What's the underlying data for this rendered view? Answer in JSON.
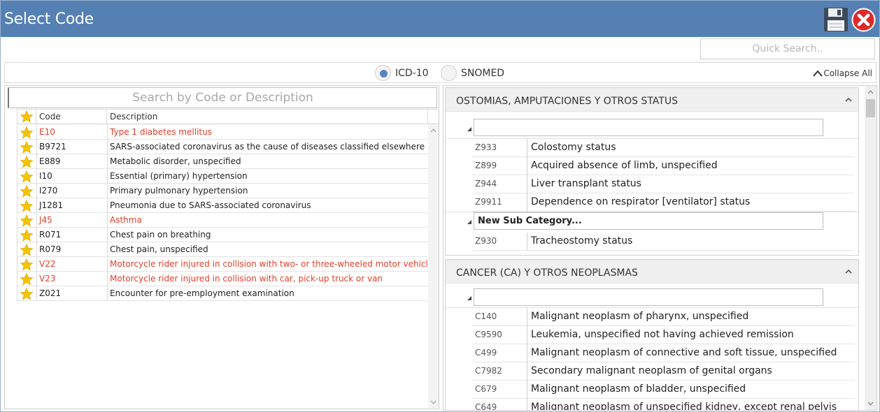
{
  "window": {
    "title": "Select Code",
    "save_icon": "floppy-disk-icon",
    "close_icon": "close-x-icon"
  },
  "quick_search": {
    "placeholder": "Quick Search.."
  },
  "code_system": {
    "options": [
      {
        "label": "ICD-10",
        "selected": true
      },
      {
        "label": "SNOMED",
        "selected": false
      }
    ],
    "collapse_all_label": "Collapse All"
  },
  "favorites": {
    "search_placeholder": "Search by Code or Description",
    "columns": {
      "code": "Code",
      "description": "Description"
    },
    "rows": [
      {
        "code": "E10",
        "description": "Type 1 diabetes mellitus",
        "highlight": true
      },
      {
        "code": "B9721",
        "description": "SARS-associated coronavirus as the cause of diseases classified elsewhere",
        "highlight": false
      },
      {
        "code": "E889",
        "description": "Metabolic disorder, unspecified",
        "highlight": false
      },
      {
        "code": "I10",
        "description": "Essential (primary) hypertension",
        "highlight": false
      },
      {
        "code": "I270",
        "description": "Primary pulmonary hypertension",
        "highlight": false
      },
      {
        "code": "J1281",
        "description": "Pneumonia due to SARS-associated coronavirus",
        "highlight": false
      },
      {
        "code": "J45",
        "description": "Asthma",
        "highlight": true
      },
      {
        "code": "R071",
        "description": "Chest pain on breathing",
        "highlight": false
      },
      {
        "code": "R079",
        "description": "Chest pain, unspecified",
        "highlight": false
      },
      {
        "code": "V22",
        "description": "Motorcycle rider injured in collision with two- or three-wheeled motor vehicle",
        "highlight": true
      },
      {
        "code": "V23",
        "description": "Motorcycle rider injured in collision with car, pick-up truck or van",
        "highlight": true
      },
      {
        "code": "Z021",
        "description": "Encounter for pre-employment examination",
        "highlight": false
      }
    ],
    "star_color": "#f5c400",
    "highlight_color": "#e0402c"
  },
  "categories": [
    {
      "title": "OSTOMIAS, AMPUTACIONES Y OTROS STATUS",
      "subcategories": [
        {
          "name": "",
          "codes": [
            {
              "code": "Z933",
              "description": "Colostomy status"
            },
            {
              "code": "Z899",
              "description": "Acquired absence of limb, unspecified"
            },
            {
              "code": "Z944",
              "description": "Liver transplant status"
            },
            {
              "code": "Z9911",
              "description": "Dependence on respirator [ventilator] status"
            }
          ]
        },
        {
          "name": "New Sub Category...",
          "codes": [
            {
              "code": "Z930",
              "description": "Tracheostomy status"
            }
          ]
        }
      ]
    },
    {
      "title": "CANCER (CA) Y OTROS NEOPLASMAS",
      "subcategories": [
        {
          "name": "",
          "codes": [
            {
              "code": "C140",
              "description": "Malignant neoplasm of pharynx, unspecified"
            },
            {
              "code": "C9590",
              "description": "Leukemia, unspecified not having achieved remission"
            },
            {
              "code": "C499",
              "description": "Malignant neoplasm of connective and soft tissue, unspecified"
            },
            {
              "code": "C7982",
              "description": "Secondary malignant neoplasm of genital organs"
            },
            {
              "code": "C679",
              "description": "Malignant neoplasm of bladder, unspecified"
            },
            {
              "code": "C649",
              "description": "Malignant neoplasm of unspecified kidney, except renal pelvis"
            }
          ]
        }
      ]
    }
  ],
  "colors": {
    "titlebar": "#5480b4",
    "radio_selected": "#5a82c0"
  }
}
